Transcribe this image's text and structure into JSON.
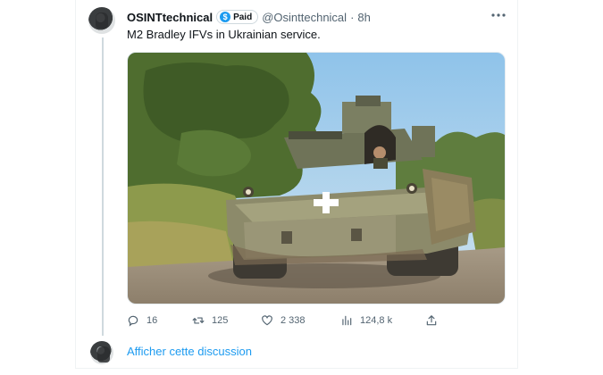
{
  "tweet": {
    "display_name": "OSINTtechnical",
    "badge_label": "Paid",
    "badge_glyph": "$",
    "handle": "@Osinttechnical",
    "separator": "·",
    "time": "8h",
    "text": "M2 Bradley IFVs in Ukrainian service.",
    "more_icon": "ellipsis-icon",
    "media": {
      "kind": "photo",
      "subject": "M2 Bradley IFV"
    }
  },
  "actions": {
    "replies": "16",
    "retweets": "125",
    "likes": "2 338",
    "views": "124,8 k"
  },
  "icons": {
    "reply": "reply-icon",
    "retweet": "retweet-icon",
    "like": "heart-icon",
    "views": "views-icon",
    "share": "share-icon"
  },
  "footer": {
    "show_thread": "Afficher cette discussion"
  },
  "colors": {
    "accent": "#1d9bf0",
    "text": "#0f1419",
    "muted": "#536471",
    "border": "#eff3f4"
  }
}
